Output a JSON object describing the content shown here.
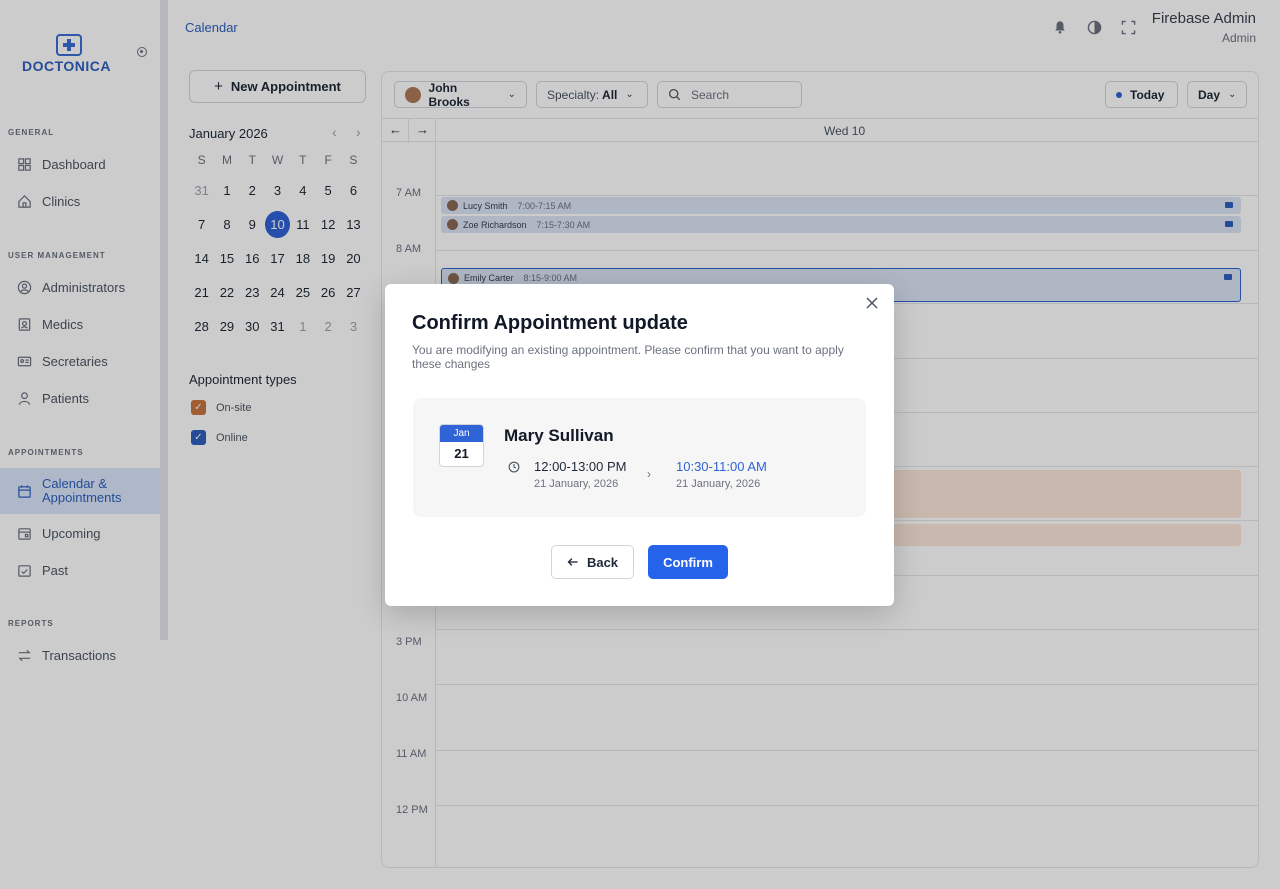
{
  "brand": {
    "name": "DOCTONICA",
    "color": "#2f5fbf"
  },
  "sidebar": {
    "sections": [
      {
        "label": "GENERAL",
        "items": [
          {
            "label": "Dashboard",
            "icon": "grid-icon"
          },
          {
            "label": "Clinics",
            "icon": "home-icon"
          }
        ]
      },
      {
        "label": "USER MANAGEMENT",
        "items": [
          {
            "label": "Administrators",
            "icon": "user-circle-icon"
          },
          {
            "label": "Medics",
            "icon": "badge-icon"
          },
          {
            "label": "Secretaries",
            "icon": "id-card-icon"
          },
          {
            "label": "Patients",
            "icon": "person-icon"
          }
        ]
      },
      {
        "label": "APPOINTMENTS",
        "items": [
          {
            "label": "Calendar & Appointments",
            "icon": "calendar-icon",
            "active": true
          },
          {
            "label": "Upcoming",
            "icon": "calendar-upcoming-icon"
          },
          {
            "label": "Past",
            "icon": "calendar-check-icon"
          }
        ]
      },
      {
        "label": "REPORTS",
        "items": [
          {
            "label": "Transactions",
            "icon": "swap-icon"
          }
        ]
      }
    ]
  },
  "header": {
    "breadcrumb": "Calendar",
    "user_name": "Firebase Admin",
    "user_role": "Admin"
  },
  "left_panel": {
    "new_appointment_label": "New Appointment",
    "month_title": "January 2026",
    "weekdays": [
      "S",
      "M",
      "T",
      "W",
      "T",
      "F",
      "S"
    ],
    "weeks": [
      [
        "31",
        "1",
        "2",
        "3",
        "4",
        "5",
        "6"
      ],
      [
        "7",
        "8",
        "9",
        "10",
        "11",
        "12",
        "13"
      ],
      [
        "14",
        "15",
        "16",
        "17",
        "18",
        "19",
        "20"
      ],
      [
        "21",
        "22",
        "23",
        "24",
        "25",
        "26",
        "27"
      ],
      [
        "28",
        "29",
        "30",
        "31",
        "1",
        "2",
        "3"
      ]
    ],
    "selected_day": "10",
    "appointment_types_title": "Appointment types",
    "types": [
      {
        "label": "On-site",
        "color": "#c8753e",
        "checked": true
      },
      {
        "label": "Online",
        "color": "#2f5fbf",
        "checked": true
      }
    ]
  },
  "toolbar": {
    "doctor": "John Brooks",
    "specialty_label": "Specialty:",
    "specialty_value": "All",
    "search_placeholder": "Search",
    "today_label": "Today",
    "view_label": "Day"
  },
  "day_view": {
    "day_label": "Wed 10",
    "hour_labels": [
      "7 AM",
      "8 AM",
      "3 PM",
      "10 AM",
      "11 AM",
      "12 PM"
    ],
    "events": [
      {
        "name": "Lucy Smith",
        "time": "7:00-7:15 AM"
      },
      {
        "name": "Zoe Richardson",
        "time": "7:15-7:30 AM"
      },
      {
        "name": "Emily Carter",
        "time": "8:15-9:00 AM"
      }
    ]
  },
  "modal": {
    "title": "Confirm Appointment update",
    "description": "You are modifying an existing appointment. Please confirm that you want to apply these changes",
    "date_month": "Jan",
    "date_day": "21",
    "patient_name": "Mary Sullivan",
    "old_time": "12:00-13:00 PM",
    "old_date": "21 January, 2026",
    "new_time": "10:30-11:00 AM",
    "new_date": "21 January, 2026",
    "back_label": "Back",
    "confirm_label": "Confirm",
    "accent_color": "#2563eb"
  }
}
